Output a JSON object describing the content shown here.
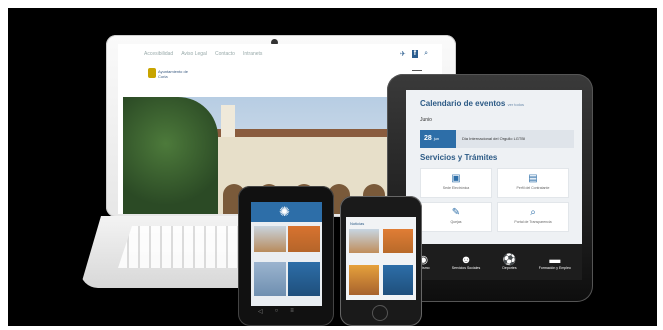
{
  "laptop": {
    "nav": [
      "Accesibilidad",
      "Aviso Legal",
      "Contacto",
      "Intranets"
    ],
    "social": [
      "twitter-icon",
      "facebook-icon",
      "search-icon"
    ],
    "logo_text": "Ayuntamiento de Coria"
  },
  "tablet": {
    "calendar_title": "Calendario de eventos",
    "calendar_link": "ver todos",
    "month": "Junio",
    "event_day": "28",
    "event_month": "jun",
    "event_title": "Dia Internacional del Orgullo LGTBI",
    "services_title": "Servicios y Trámites",
    "services": [
      {
        "icon": "monitor-icon",
        "label": "Sede Electrónica"
      },
      {
        "icon": "document-icon",
        "label": "Perfil del Contratante"
      },
      {
        "icon": "edit-icon",
        "label": "Quejas"
      },
      {
        "icon": "search-icon",
        "label": "Portal de Transparencia"
      }
    ],
    "footer": [
      {
        "icon": "camera-icon",
        "label": "Turismo"
      },
      {
        "icon": "people-icon",
        "label": "Servicios Sociales"
      },
      {
        "icon": "soccer-icon",
        "label": "Deportes"
      },
      {
        "icon": "briefcase-icon",
        "label": "Formación y Empleo"
      }
    ]
  },
  "phone_small": {
    "header": "Noticias"
  },
  "colors": {
    "brand": "#2d6ea8",
    "heading": "#2d5b86"
  }
}
